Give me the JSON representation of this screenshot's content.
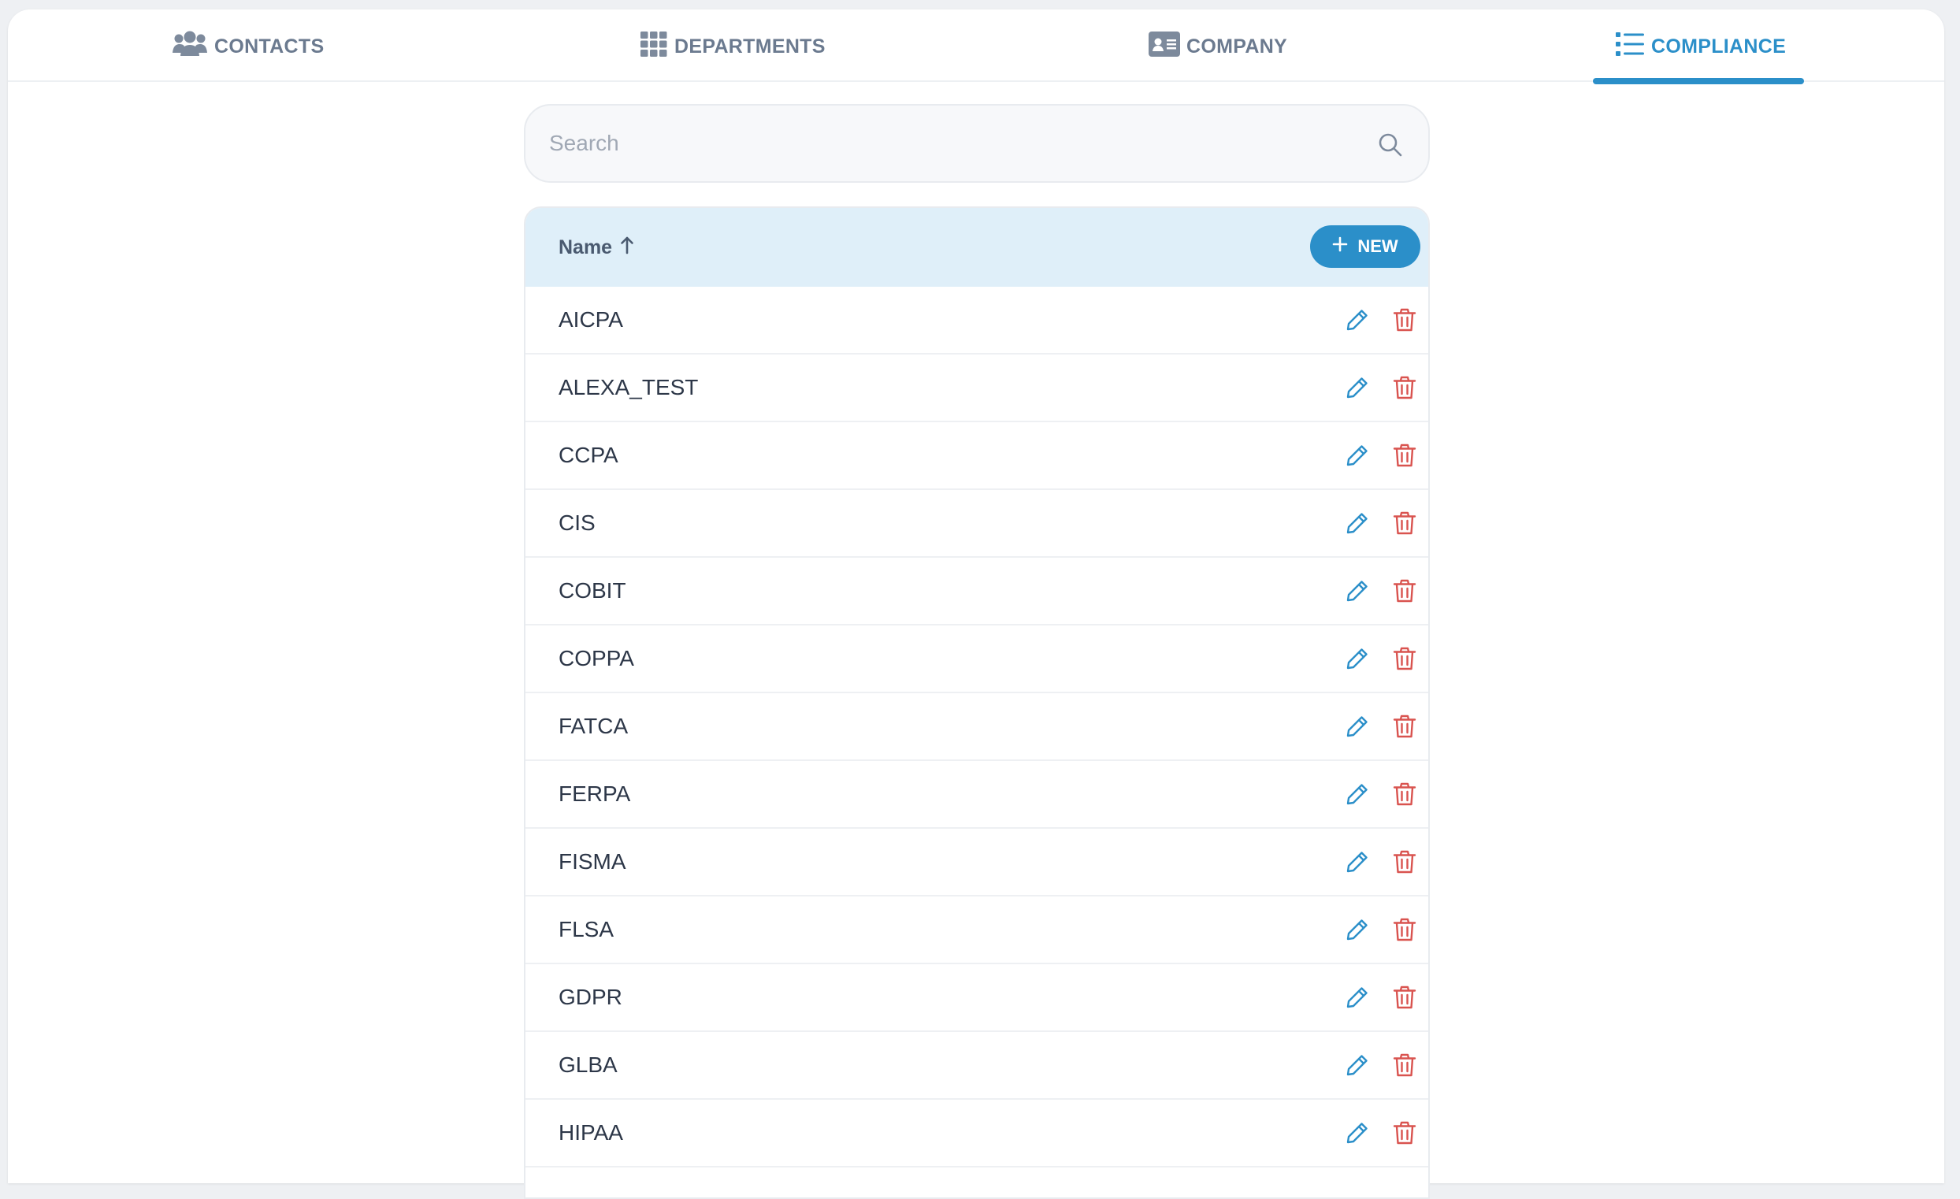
{
  "tabs": [
    {
      "label": "CONTACTS",
      "icon": "users-icon",
      "active": false
    },
    {
      "label": "DEPARTMENTS",
      "icon": "grid-icon",
      "active": false
    },
    {
      "label": "COMPANY",
      "icon": "id-card-icon",
      "active": false
    },
    {
      "label": "COMPLIANCE",
      "icon": "list-icon",
      "active": true
    }
  ],
  "search": {
    "placeholder": "Search",
    "value": "",
    "icon": "search-icon"
  },
  "table": {
    "header": {
      "name_label": "Name",
      "sort": "ascending",
      "sort_icon": "arrow-up-icon"
    },
    "new_button_label": "NEW",
    "rows": [
      "AICPA",
      "ALEXA_TEST",
      "CCPA",
      "CIS",
      "COBIT",
      "COPPA",
      "FATCA",
      "FERPA",
      "FISMA",
      "FLSA",
      "GDPR",
      "GLBA",
      "HIPAA"
    ],
    "row_actions": [
      "pencil-icon",
      "trash-icon"
    ]
  },
  "colors": {
    "accent": "#2b8fc9",
    "inactive_tab": "#6b7a8f",
    "header_bg": "#dfeff9",
    "delete": "#d9534f",
    "edit": "#2b8fc9"
  }
}
